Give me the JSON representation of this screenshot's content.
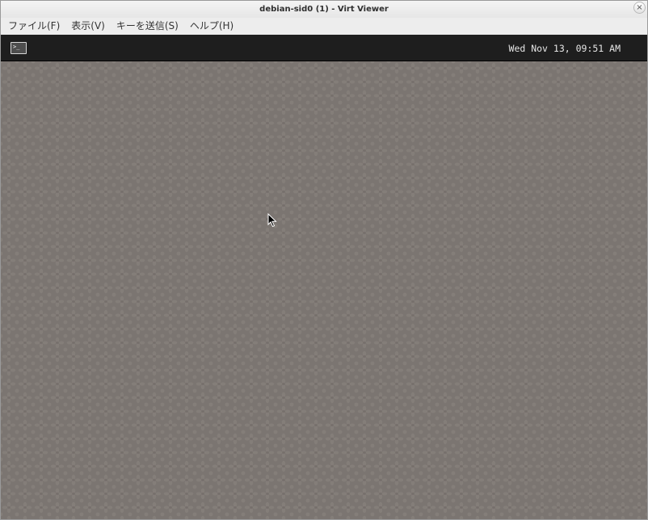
{
  "window": {
    "title": "debian-sid0 (1) - Virt Viewer",
    "close_glyph": "×"
  },
  "menubar": {
    "items": [
      {
        "label": "ファイル(F)"
      },
      {
        "label": "表示(V)"
      },
      {
        "label": "キーを送信(S)"
      },
      {
        "label": "ヘルプ(H)"
      }
    ]
  },
  "guest": {
    "panel": {
      "app_icon": "terminal-icon",
      "app_icon_glyph": ">_",
      "clock": "Wed Nov 13, 09:51 AM"
    },
    "desktop": {
      "wallpaper_color": "#7b7571",
      "pattern_color": "#8b8480",
      "pointer_icon": "mouse-pointer-icon"
    }
  },
  "colors": {
    "panel_bg": "#1e1e1e",
    "window_bg": "#ededed"
  }
}
